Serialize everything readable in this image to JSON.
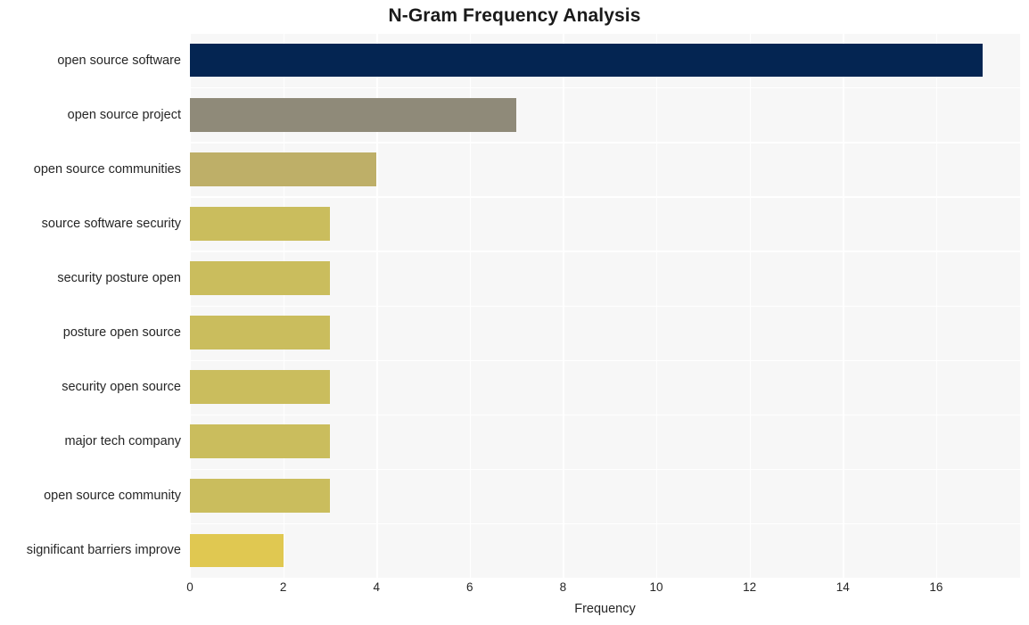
{
  "chart_data": {
    "type": "bar",
    "orientation": "horizontal",
    "title": "N-Gram Frequency Analysis",
    "xlabel": "Frequency",
    "ylabel": "",
    "categories": [
      "open source software",
      "open source project",
      "open source communities",
      "source software security",
      "security posture open",
      "posture open source",
      "security open source",
      "major tech company",
      "open source community",
      "significant barriers improve"
    ],
    "values": [
      17,
      7,
      4,
      3,
      3,
      3,
      3,
      3,
      3,
      2
    ],
    "bar_colors": [
      "#042552",
      "#8f8a79",
      "#beaf68",
      "#cabd5d",
      "#cabd5d",
      "#cabd5d",
      "#cabd5d",
      "#cabd5d",
      "#cabd5d",
      "#e0c851"
    ],
    "xlim": [
      0,
      17.8
    ],
    "xticks": [
      0,
      2,
      4,
      6,
      8,
      10,
      12,
      14,
      16
    ],
    "xtick_labels": [
      "0",
      "2",
      "4",
      "6",
      "8",
      "10",
      "12",
      "14",
      "16"
    ],
    "grid": true,
    "grid_color": "#ffffff",
    "plot_background": "#f7f7f7",
    "figure_background": "#ffffff",
    "legend": null
  }
}
